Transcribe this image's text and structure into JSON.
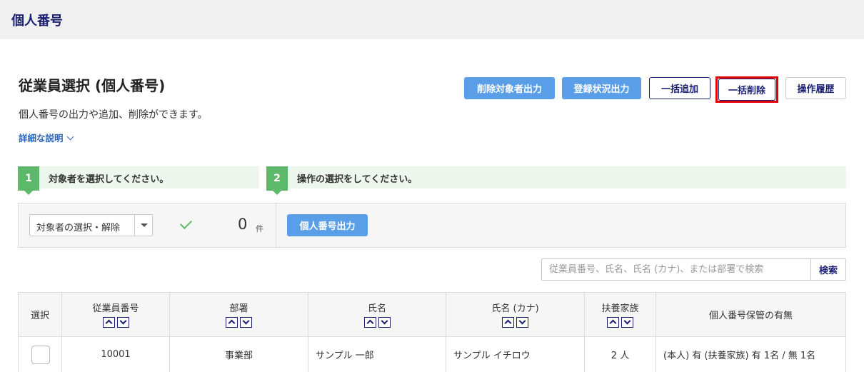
{
  "header": {
    "title": "個人番号"
  },
  "page": {
    "title": "従業員選択 (個人番号)",
    "subtitle": "個人番号の出力や追加、削除ができます。",
    "detail_link": "詳細な説明"
  },
  "toolbar": {
    "export_deletion_targets": "削除対象者出力",
    "export_registration_status": "登録状況出力",
    "bulk_add": "一括追加",
    "bulk_delete": "一括削除",
    "operation_history": "操作履歴"
  },
  "steps": [
    {
      "num": "1",
      "text": "対象者を選択してください。"
    },
    {
      "num": "2",
      "text": "操作の選択をしてください。"
    }
  ],
  "selection": {
    "select_value": "対象者の選択・解除",
    "count": "0",
    "count_unit": "件",
    "export_button": "個人番号出力"
  },
  "search": {
    "placeholder": "従業員番号、氏名、氏名 (カナ)、または部署で検索",
    "button": "検索"
  },
  "table": {
    "headers": {
      "select": "選択",
      "employee_no": "従業員番号",
      "department": "部署",
      "name": "氏名",
      "name_kana": "氏名 (カナ)",
      "dependents": "扶養家族",
      "holding": "個人番号保管の有無"
    },
    "rows": [
      {
        "employee_no": "10001",
        "department": "事業部",
        "name": "サンプル 一郎",
        "name_kana": "サンプル イチロウ",
        "dependents": "2 人",
        "holding": "(本人) 有 (扶養家族) 有 1名 / 無 1名"
      }
    ]
  },
  "colors": {
    "accent_blue": "#5a9ee8",
    "navy": "#1a1f71",
    "step_green": "#5db86a",
    "highlight_red": "#e00000"
  }
}
